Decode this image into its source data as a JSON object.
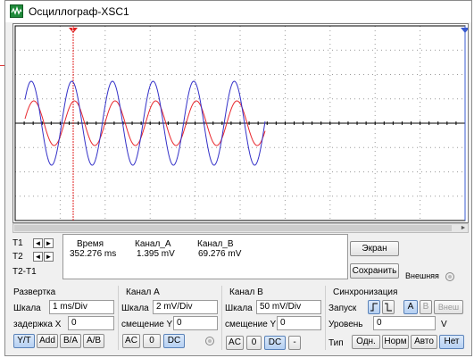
{
  "window": {
    "title": "Осциллограф-XSC1"
  },
  "cursors": {
    "t1_label": "T1",
    "t2_label": "T2",
    "t2t1_label": "T2-T1"
  },
  "readout": {
    "headers": [
      "Время",
      "Канал_A",
      "Канал_B"
    ],
    "row": [
      "352.276 ms",
      "1.395 mV",
      "69.276 mV"
    ]
  },
  "right_buttons": {
    "screen": "Экран",
    "save": "Сохранить",
    "external": "Внешняя"
  },
  "timebase": {
    "title": "Развертка",
    "scale_label": "Шкала",
    "scale_value": "1 ms/Div",
    "delay_label": "задержка X",
    "delay_value": "0",
    "buttons": [
      "Y/T",
      "Add",
      "B/A",
      "A/B"
    ]
  },
  "channel_a": {
    "title": "Канал A",
    "scale_label": "Шкала",
    "scale_value": "2 mV/Div",
    "offset_label": "смещение Y",
    "offset_value": "0",
    "buttons": [
      "AC",
      "0",
      "DC"
    ]
  },
  "channel_b": {
    "title": "Канал B",
    "scale_label": "Шкала",
    "scale_value": "50 mV/Div",
    "offset_label": "смещение Y",
    "offset_value": "0",
    "buttons": [
      "AC",
      "0",
      "DC",
      "-"
    ]
  },
  "trigger": {
    "title": "Синхронизация",
    "start_label": "Запуск",
    "edge_buttons": [
      "A",
      "B",
      "Внеш"
    ],
    "level_label": "Уровень",
    "level_value": "0",
    "level_unit": "V",
    "type_label": "Тип",
    "type_buttons": [
      "Одн.",
      "Норм",
      "Авто",
      "Нет"
    ]
  },
  "colors": {
    "channel_a": "#e8282e",
    "channel_b": "#3431c8",
    "accent": "#2f6fcf"
  }
}
